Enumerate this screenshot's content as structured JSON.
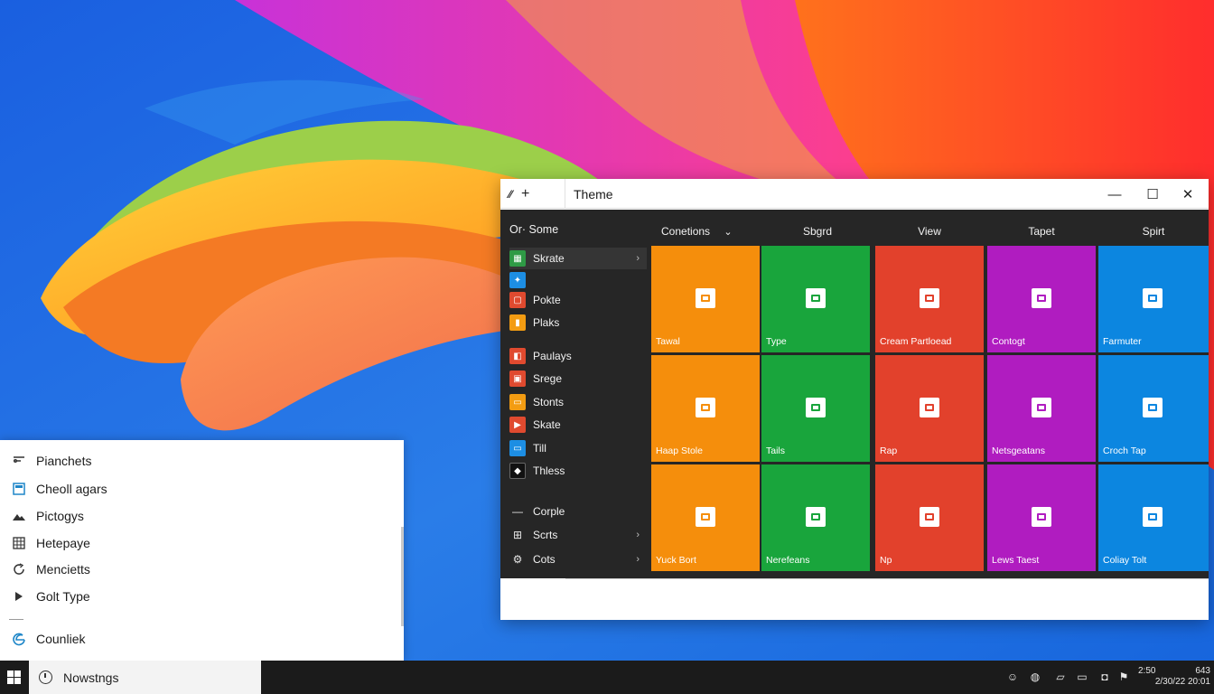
{
  "desktop": {
    "wallpaper_colors": [
      "#1565d8",
      "#f5a623",
      "#e83fb0",
      "#ff5a1f",
      "#fbd13a"
    ]
  },
  "flyout": {
    "items": [
      {
        "label": "Pianchets",
        "icon": "chat-icon"
      },
      {
        "label": "Cheoll agars",
        "icon": "window-icon"
      },
      {
        "label": "Pictogys",
        "icon": "image-icon"
      },
      {
        "label": "Hetepaye",
        "icon": "grid-icon"
      },
      {
        "label": "Mencietts",
        "icon": "refresh-icon"
      },
      {
        "label": "Golt Type",
        "icon": "play-icon"
      },
      {
        "label": "Counliek",
        "icon": "edge-icon"
      }
    ]
  },
  "window": {
    "title": "Theme",
    "titlebar_icons": [
      "pin-icon",
      "plus-icon"
    ],
    "controls": {
      "minimize": "—",
      "maximize": "☐",
      "close": "✕"
    },
    "sidebar": {
      "header": "Or· Some",
      "items": [
        {
          "label": "Skrate",
          "color": "#2e9a45",
          "chevron": "›",
          "active": true
        },
        {
          "label": "",
          "color": "#1d8ee3"
        },
        {
          "label": "Pokte",
          "color": "#e04a2f"
        },
        {
          "label": "Plaks",
          "color": "#f39c12"
        },
        {
          "label": "Paulays",
          "color": "#e04a2f"
        },
        {
          "label": "Srege",
          "color": "#e04a2f"
        },
        {
          "label": "Stonts",
          "color": "#f39c12"
        },
        {
          "label": "Skate",
          "color": "#e04a2f"
        },
        {
          "label": "Till",
          "color": "#1d8ee3"
        },
        {
          "label": "Thless",
          "color": "#1f1f1f"
        }
      ],
      "bottom_items": [
        {
          "label": "Corple",
          "symbol": "—"
        },
        {
          "label": "Scrts",
          "symbol": "⊞",
          "chevron": "›"
        },
        {
          "label": "Cots",
          "symbol": "⚙",
          "chevron": "›"
        }
      ]
    },
    "columns": [
      {
        "label": "Conetions",
        "chevron": "⌄"
      },
      {
        "label": "Sbgrd"
      },
      {
        "label": "View"
      },
      {
        "label": "Tapet"
      },
      {
        "label": "Spirt"
      }
    ],
    "tile_colors": [
      "#f58e0c",
      "#19a53c",
      "#e2412c",
      "#b01cc0",
      "#0c86e0"
    ],
    "tiles": [
      [
        {
          "label": "Tawal"
        },
        {
          "label": "Type"
        },
        {
          "label": "Cream Partloead"
        },
        {
          "label": "Contogt"
        },
        {
          "label": "Farmuter"
        }
      ],
      [
        {
          "label": "Haap Stole"
        },
        {
          "label": "Tails"
        },
        {
          "label": "Rap"
        },
        {
          "label": "Netsgeatans"
        },
        {
          "label": "Croch Tap"
        }
      ],
      [
        {
          "label": "Yuck Bort"
        },
        {
          "label": "Nerefeans"
        },
        {
          "label": "Np"
        },
        {
          "label": "Lews Taest"
        },
        {
          "label": "Coliay Tolt"
        }
      ]
    ]
  },
  "taskbar": {
    "search_text": "Nowstngs",
    "tray_icons": [
      "smile-icon",
      "globe-icon",
      "chat-icon",
      "display-icon",
      "shield-icon",
      "flag-icon"
    ],
    "clock_time_1": "2:50",
    "clock_time_2": "643",
    "clock_date": "2/30/22  20:01"
  }
}
